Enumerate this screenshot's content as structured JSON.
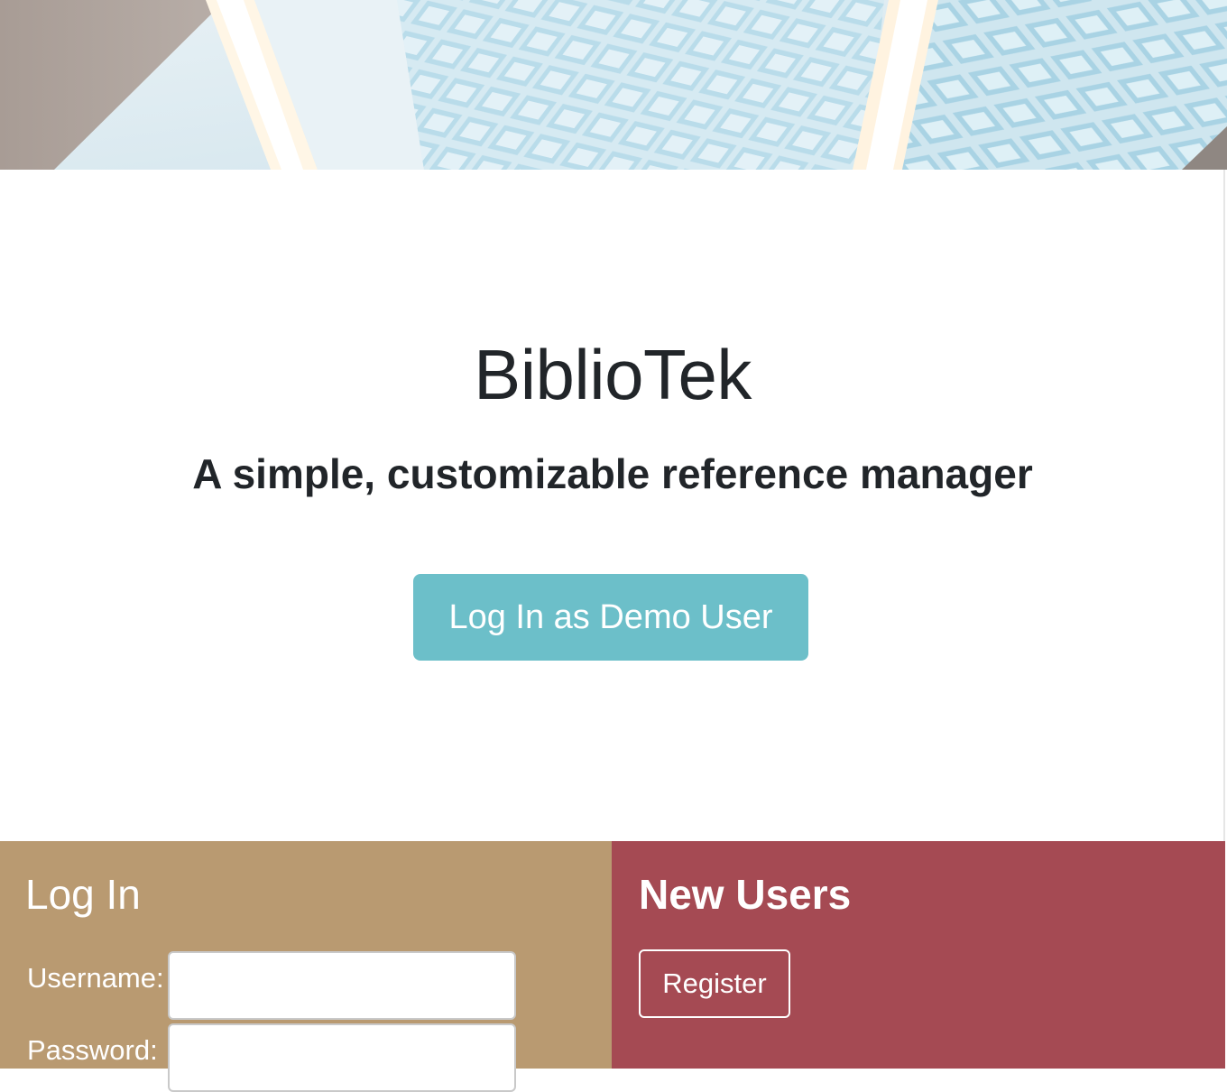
{
  "hero": {
    "title": "BiblioTek",
    "subtitle": "A simple, customizable reference manager",
    "demo_button_label": "Log In as Demo User"
  },
  "login": {
    "heading": "Log In",
    "username_label": "Username:",
    "username_value": "",
    "password_label": "Password:",
    "password_value": ""
  },
  "new_users": {
    "heading": "New Users",
    "register_label": "Register"
  },
  "colors": {
    "demo_button": "#6cbfc9",
    "login_panel": "#b99a71",
    "new_users_panel": "#a54a53",
    "text_dark": "#212529"
  }
}
